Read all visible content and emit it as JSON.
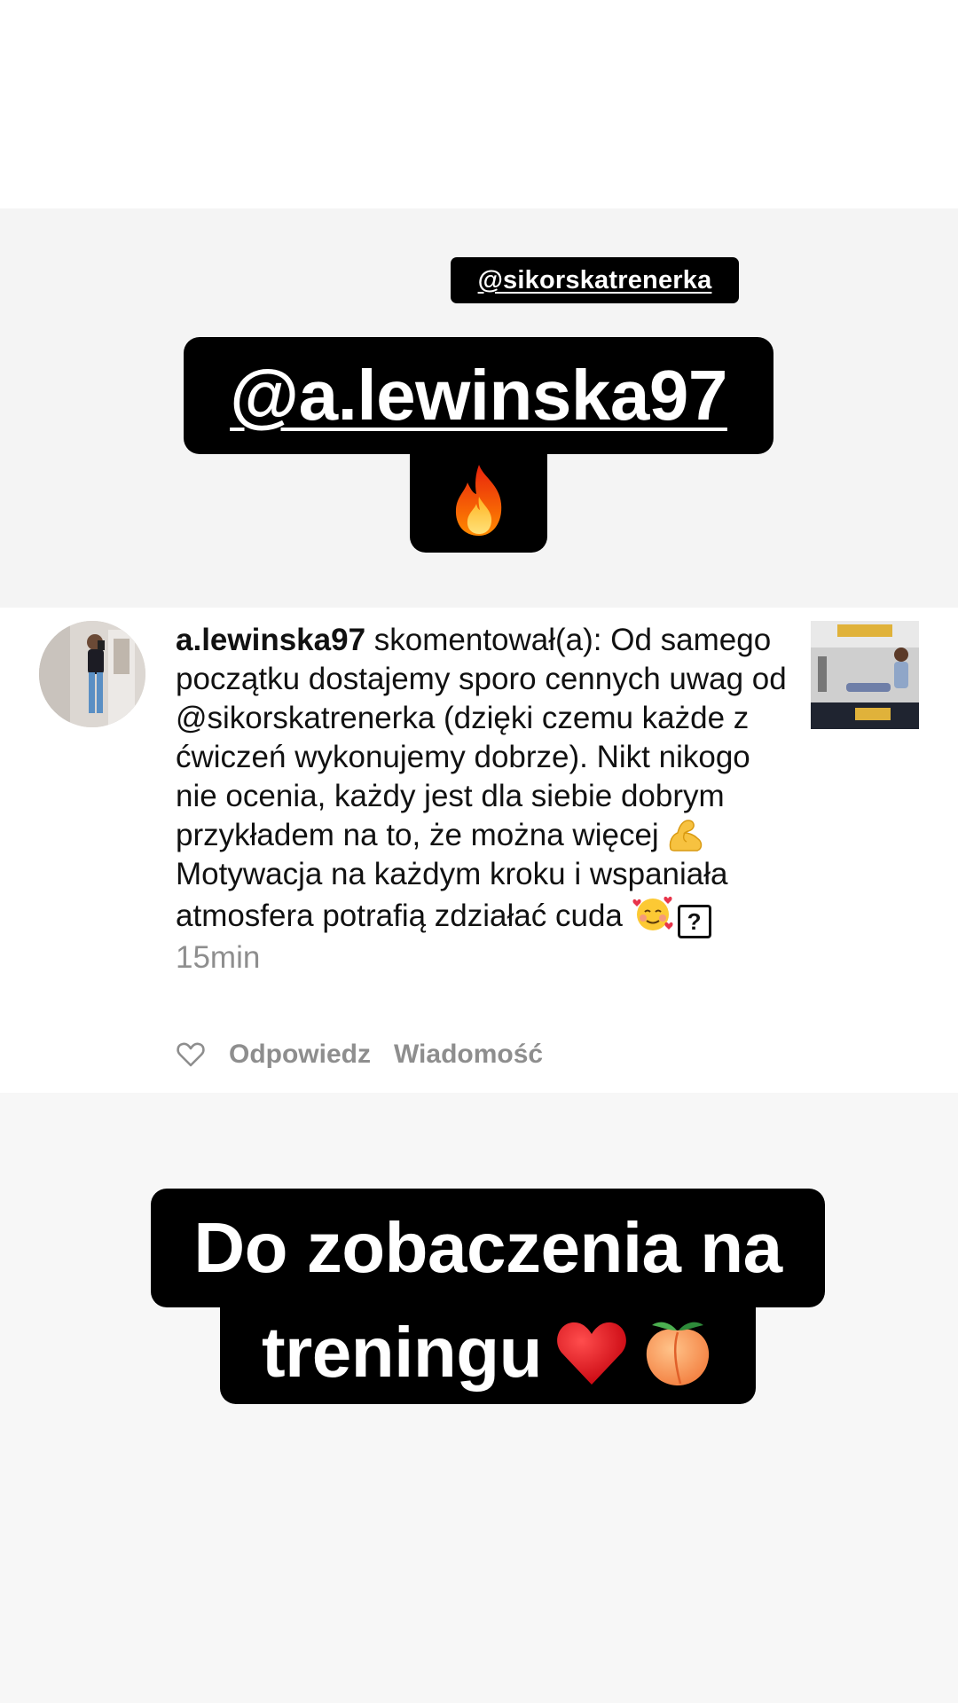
{
  "story": {
    "mention_small": "@sikorskatrenerka",
    "mention_big": "@a.lewinska97",
    "fire_emoji": "fire-icon",
    "caption": {
      "line1": "Do zobaczenia na",
      "line2": "treningu"
    }
  },
  "comment": {
    "username": "a.lewinska97",
    "action": " skomentował(a): ",
    "text_part1": "Od samego początku dostajemy sporo cennych uwag od @sikorskatrenerka (dzięki czemu każde z ćwiczeń wykonujemy dobrze). Nikt nikogo nie ocenia, każdy jest dla siebie dobrym przykładem na to, że można więcej ",
    "text_part2": "Motywacja na każdym kroku i wspaniała atmosfera potrafią zdziałać cuda ",
    "question_mark": "?",
    "time": "15min",
    "actions": {
      "reply": "Odpowiedz",
      "message": "Wiadomość"
    }
  },
  "colors": {
    "sticker_bg": "#000000",
    "muted_text": "#8e8e8e"
  }
}
